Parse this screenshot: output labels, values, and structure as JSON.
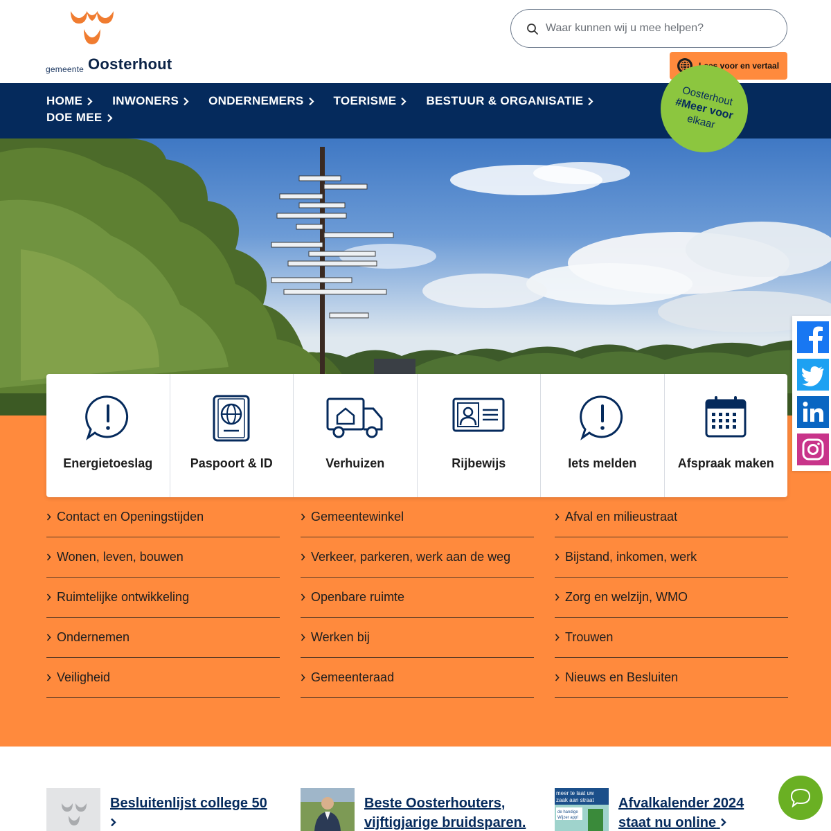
{
  "header": {
    "logo": {
      "prefix": "gemeente",
      "name": "Oosterhout"
    },
    "search": {
      "placeholder": "Waar kunnen wij u mee helpen?"
    },
    "readspeaker": {
      "label": "Lees voor en vertaal"
    }
  },
  "nav": {
    "items": [
      {
        "label": "HOME"
      },
      {
        "label": "INWONERS"
      },
      {
        "label": "ONDERNEMERS"
      },
      {
        "label": "TOERISME"
      },
      {
        "label": "BESTUUR & ORGANISATIE"
      },
      {
        "label": "DOE MEE"
      }
    ]
  },
  "badge": {
    "line1": "Oosterhout",
    "line2": "#Meer voor",
    "line3": "elkaar"
  },
  "hero": {
    "signpost_words": [
      "Geen Land",
      "Maar Water",
      "Geen Water",
      "Maar Land",
      "Land Dat Op Water",
      "Drijft",
      "Vlak Land Derhalve",
      "Twee Kanalen",
      "Die Elkaar Snijden",
      "Liggen In Hetzelfde Vlak",
      "Een Gesneden Woord",
      "Waarin Gesneden Woord",
      "Vaarwater"
    ]
  },
  "tiles": [
    {
      "label": "Energietoeslag",
      "icon": "exclamation-bubble-icon"
    },
    {
      "label": "Paspoort & ID",
      "icon": "passport-icon"
    },
    {
      "label": "Verhuizen",
      "icon": "moving-truck-icon"
    },
    {
      "label": "Rijbewijs",
      "icon": "drivers-license-icon"
    },
    {
      "label": "Iets melden",
      "icon": "exclamation-bubble-icon"
    },
    {
      "label": "Afspraak maken",
      "icon": "calendar-icon"
    }
  ],
  "links": [
    {
      "label": "Contact en Openingstijden"
    },
    {
      "label": "Gemeentewinkel"
    },
    {
      "label": "Afval en milieustraat"
    },
    {
      "label": "Wonen, leven, bouwen"
    },
    {
      "label": "Verkeer, parkeren, werk aan de weg"
    },
    {
      "label": "Bijstand, inkomen, werk"
    },
    {
      "label": "Ruimtelijke ontwikkeling"
    },
    {
      "label": "Openbare ruimte"
    },
    {
      "label": "Zorg en welzijn, WMO"
    },
    {
      "label": "Ondernemen"
    },
    {
      "label": "Werken bij"
    },
    {
      "label": "Trouwen"
    },
    {
      "label": "Veiligheid"
    },
    {
      "label": "Gemeenteraad"
    },
    {
      "label": "Nieuws en Besluiten"
    }
  ],
  "news": [
    {
      "title_line1": "Besluitenlijst college 50",
      "title_line2": ""
    },
    {
      "title_line1": "Beste Oosterhouters,",
      "title_line2": "vijftigjarige bruidsparen."
    },
    {
      "title_line1": "Afvalkalender 2024",
      "title_line2": "staat nu online"
    }
  ],
  "news_thumb_text": {
    "line1": "meer te laat uw",
    "line2": "zaak aan straat",
    "line3": "de handige",
    "line4": "Wijzer app!"
  },
  "social": [
    "facebook-icon",
    "twitter-icon",
    "linkedin-icon",
    "instagram-icon"
  ],
  "colors": {
    "navy": "#052a5c",
    "orange": "#ff8a3d",
    "green": "#8cc63f",
    "chat": "#6ab023"
  }
}
